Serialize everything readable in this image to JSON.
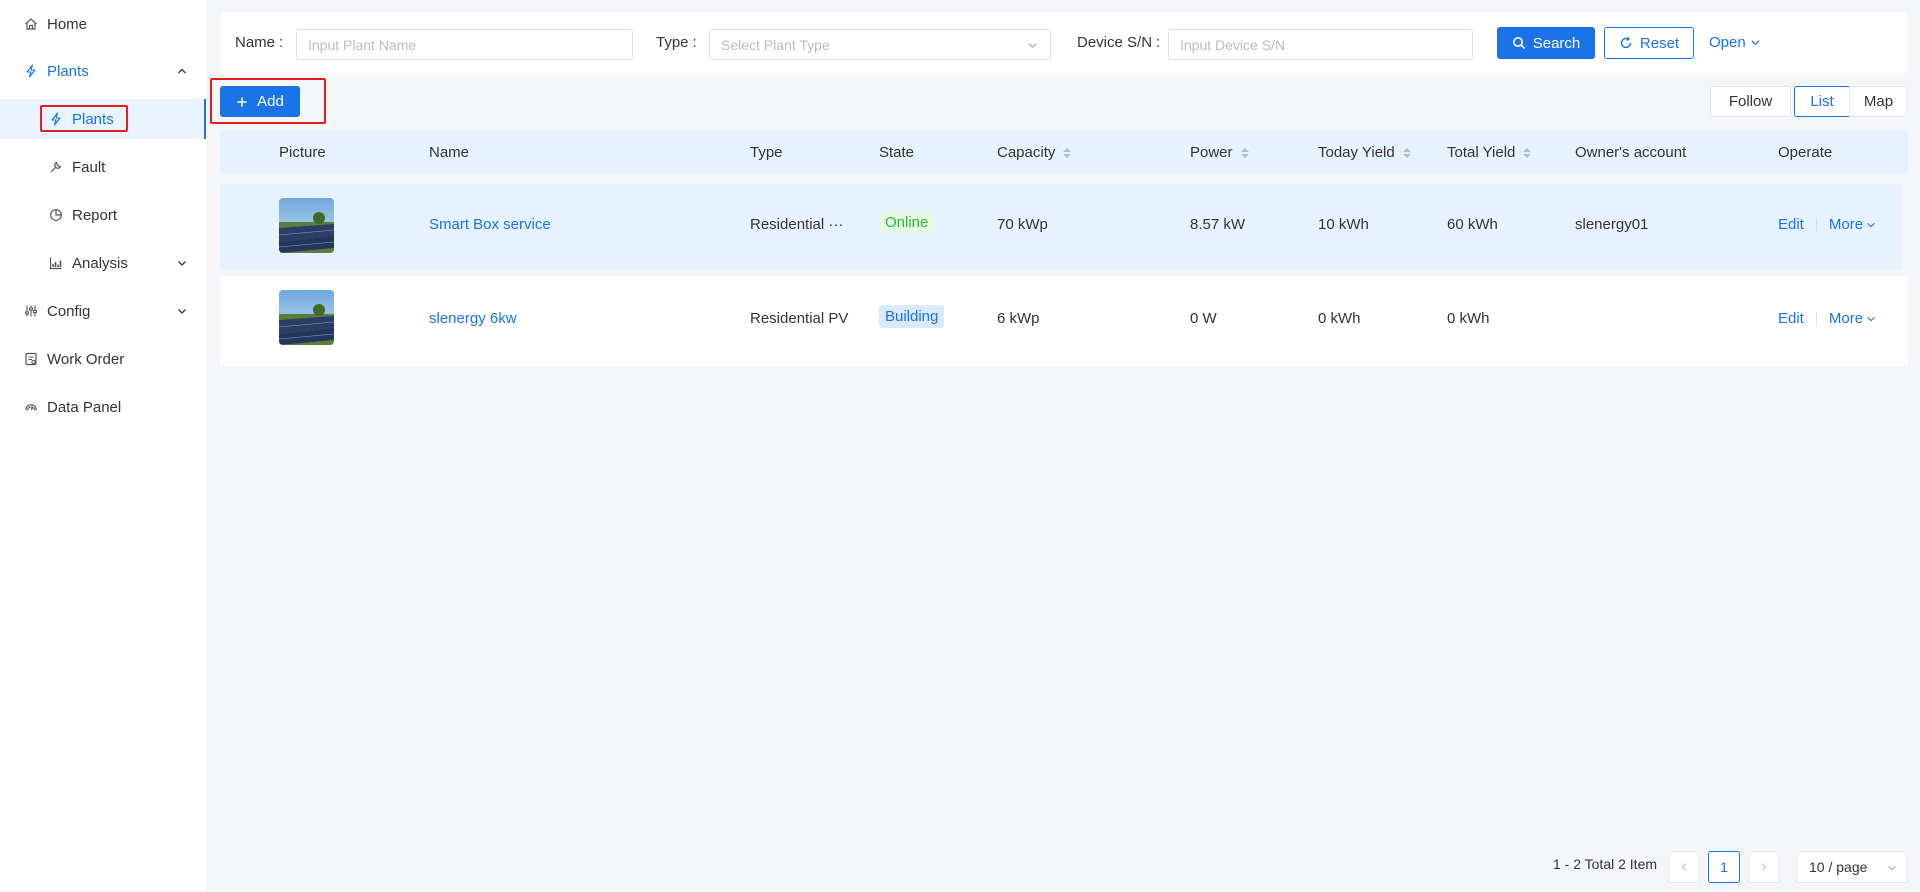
{
  "sidebar": {
    "items": [
      {
        "label": "Home",
        "icon": "home-icon"
      },
      {
        "label": "Plants",
        "icon": "bolt-icon"
      },
      {
        "label": "Plants",
        "icon": "bolt-icon"
      },
      {
        "label": "Fault",
        "icon": "wrench-icon"
      },
      {
        "label": "Report",
        "icon": "pie-chart-icon"
      },
      {
        "label": "Analysis",
        "icon": "bar-chart-icon"
      },
      {
        "label": "Config",
        "icon": "sliders-icon"
      },
      {
        "label": "Work Order",
        "icon": "clipboard-icon"
      },
      {
        "label": "Data Panel",
        "icon": "gauge-icon"
      }
    ]
  },
  "filters": {
    "name_label": "Name",
    "name_placeholder": "Input Plant Name",
    "type_label": "Type",
    "type_placeholder": "Select Plant Type",
    "sn_label": "Device S/N",
    "sn_placeholder": "Input Device S/N",
    "search_label": "Search",
    "reset_label": "Reset",
    "open_label": "Open"
  },
  "toolbar": {
    "add_label": "Add",
    "views": {
      "follow": "Follow",
      "list": "List",
      "map": "Map"
    },
    "active_view": "List"
  },
  "table": {
    "columns": {
      "picture": "Picture",
      "name": "Name",
      "type": "Type",
      "state": "State",
      "capacity": "Capacity",
      "power": "Power",
      "today_yield": "Today Yield",
      "total_yield": "Total Yield",
      "owner": "Owner's account",
      "operate": "Operate"
    },
    "rows": [
      {
        "name": "Smart Box service",
        "type": "Residential ···",
        "state": "Online",
        "capacity": "70 kWp",
        "power": "8.57 kW",
        "today_yield": "10 kWh",
        "total_yield": "60 kWh",
        "owner": "slenergy01",
        "edit": "Edit",
        "more": "More"
      },
      {
        "name": "slenergy 6kw",
        "type": "Residential PV",
        "state": "Building",
        "capacity": "6 kWp",
        "power": "0 W",
        "today_yield": "0 kWh",
        "total_yield": "0 kWh",
        "owner": "",
        "edit": "Edit",
        "more": "More"
      }
    ]
  },
  "pagination": {
    "summary": "1 - 2 Total 2 Item",
    "current_page": "1",
    "page_size": "10 / page"
  },
  "colors": {
    "primary": "#1a73e8",
    "highlight_box": "#e02020",
    "online": "#2eb82e",
    "row_highlight": "#e6f2ff"
  }
}
